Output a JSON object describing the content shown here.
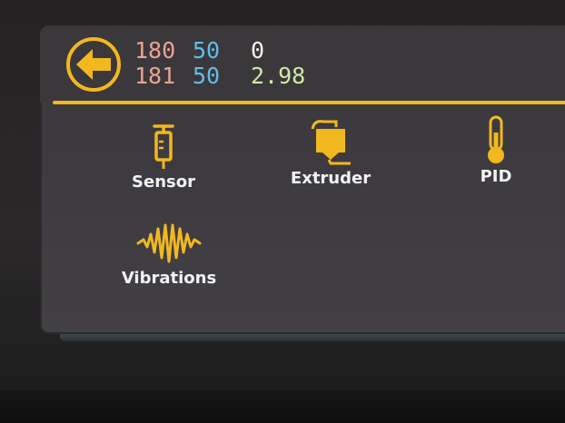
{
  "header": {
    "back_icon": "arrow-left-icon",
    "row1": {
      "extruder": "180",
      "bed": "50",
      "fan": "0"
    },
    "row2": {
      "extruder": "181",
      "bed": "50",
      "fan": "2.98"
    }
  },
  "menu": {
    "items": [
      {
        "label": "Sensor",
        "icon": "syringe-icon"
      },
      {
        "label": "Extruder",
        "icon": "extruder-icon"
      },
      {
        "label": "PID",
        "icon": "thermometer-icon"
      },
      {
        "label": "Vibrations",
        "icon": "waveform-icon"
      }
    ]
  },
  "colors": {
    "accent": "#f2b81f",
    "extruder_temp": "#e9a394",
    "bed_temp": "#62bde8",
    "fan_value": "#cfe9a5"
  }
}
